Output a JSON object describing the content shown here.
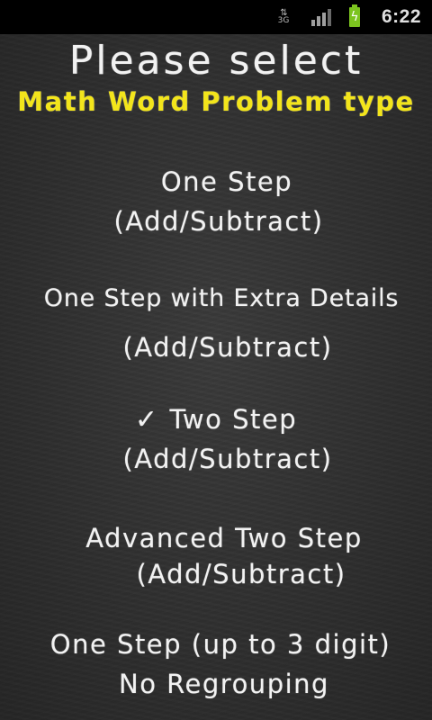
{
  "status_bar": {
    "network_type": "3G",
    "network_icon": "data-transfer-icon",
    "signal_icon": "signal-strength-icon",
    "battery_icon": "battery-charging-icon",
    "battery_color": "#7cc41f",
    "time": "6:22"
  },
  "header": {
    "title": "Please select",
    "subtitle": "Math Word Problem type",
    "subtitle_color": "#f3e51b"
  },
  "options": [
    {
      "line1": "One Step",
      "line2": "(Add/Subtract)",
      "selected": false
    },
    {
      "line1": "One Step with Extra Details",
      "line2": "(Add/Subtract)",
      "selected": false
    },
    {
      "line1": "Two Step",
      "line2": "(Add/Subtract)",
      "selected": true,
      "check_mark": "✓"
    },
    {
      "line1": "Advanced Two Step",
      "line2": "(Add/Subtract)",
      "selected": false
    },
    {
      "line1": "One Step (up to 3 digit)",
      "line2": "No Regrouping",
      "selected": false
    }
  ],
  "theme": {
    "board_color": "#3a3a3a",
    "chalk_color": "#f2f2f2"
  }
}
